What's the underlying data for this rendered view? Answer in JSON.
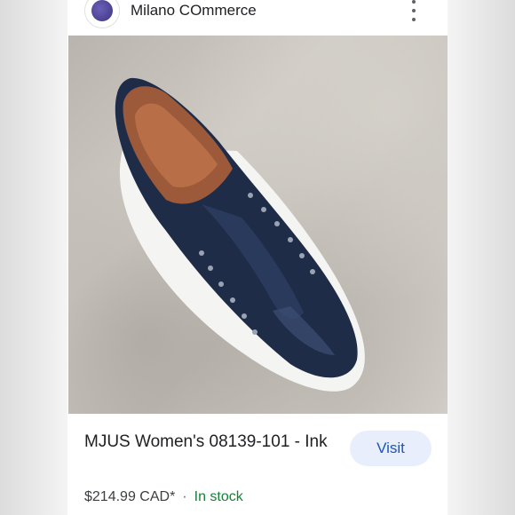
{
  "header": {
    "store_name": "Milano COmmerce",
    "logo_icon": "store-logo-icon",
    "menu_icon": "more-vert-icon"
  },
  "product": {
    "image_alt": "navy leather slip-on sneaker",
    "title": "MJUS Women's 08139-101 - Ink",
    "price": "$214.99 CAD*",
    "separator": "·",
    "availability": "In stock"
  },
  "actions": {
    "visit_label": "Visit"
  },
  "colors": {
    "accent": "#1a57b8",
    "visit_bg": "#e8eefb",
    "in_stock": "#188038"
  }
}
